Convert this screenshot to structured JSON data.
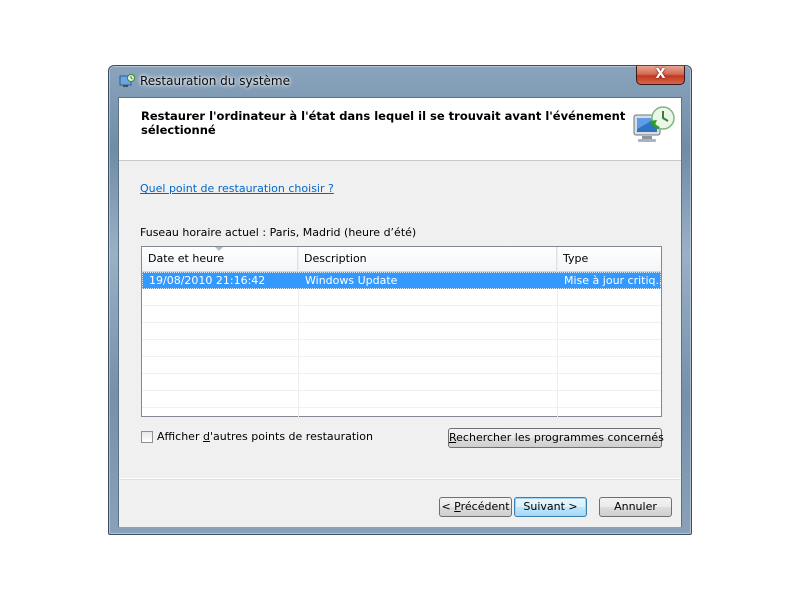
{
  "window": {
    "title": "Restauration du système",
    "close_label": "X"
  },
  "header": {
    "text": "Restaurer l'ordinateur à l'état dans lequel il se trouvait avant l'événement sélectionné",
    "icon": "system-restore-monitor-icon"
  },
  "body": {
    "help_link": "Quel point de restauration choisir ?",
    "timezone": "Fuseau horaire actuel : Paris, Madrid (heure d’été)"
  },
  "table": {
    "columns": [
      "Date et heure",
      "Description",
      "Type"
    ],
    "rows": [
      {
        "date": "19/08/2010 21:16:42",
        "description": "Windows Update",
        "type": "Mise à jour critiq..."
      }
    ]
  },
  "options": {
    "show_more_label_prefix": "Afficher ",
    "show_more_label_accel": "d",
    "show_more_label_suffix": "'autres points de restauration",
    "show_more_checked": false,
    "scan_button_accel": "R",
    "scan_button_rest": "echercher les programmes concernés"
  },
  "footer": {
    "back_prefix": "< ",
    "back_accel": "P",
    "back_rest": "récédent",
    "next_label": "Suivant >",
    "cancel_label": "Annuler"
  },
  "colors": {
    "selection": "#3399ff",
    "link": "#0066cc",
    "close_button": "#c0391f"
  }
}
